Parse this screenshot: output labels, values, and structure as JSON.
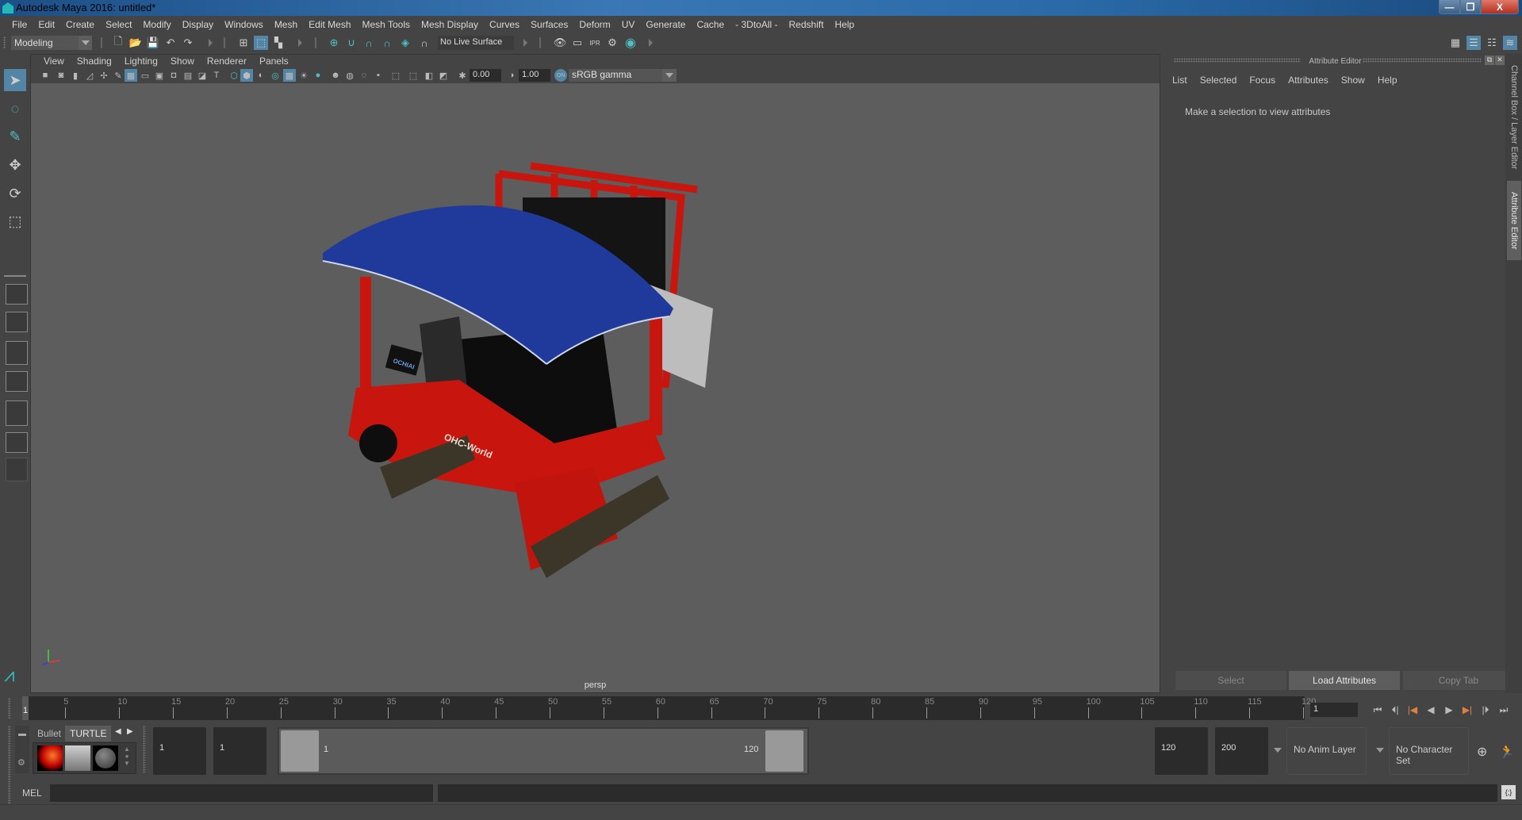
{
  "window": {
    "title": "Autodesk Maya 2016: untitled*",
    "controls": {
      "minimize": "—",
      "maximize": "❐",
      "close": "X"
    }
  },
  "menubar": {
    "items": [
      "File",
      "Edit",
      "Create",
      "Select",
      "Modify",
      "Display",
      "Windows",
      "Mesh",
      "Edit Mesh",
      "Mesh Tools",
      "Mesh Display",
      "Curves",
      "Surfaces",
      "Deform",
      "UV",
      "Generate",
      "Cache",
      "- 3DtoAll -",
      "Redshift",
      "Help"
    ]
  },
  "statusline": {
    "mode": "Modeling",
    "live_surface": "No Live Surface",
    "icons": [
      "new-scene",
      "open-scene",
      "save-scene",
      "undo",
      "redo",
      "select-by-hierarchy",
      "select-by-object",
      "select-by-component",
      "snap-to-grid",
      "snap-to-curve",
      "snap-to-point",
      "snap-to-view-plane",
      "make-live",
      "snap-to-surface",
      "render-view",
      "render-current-frame",
      "ipr-render",
      "render-settings",
      "hypershade"
    ]
  },
  "toolbox": {
    "tools": [
      "select-tool",
      "lasso-tool",
      "paint-select-tool",
      "move-tool",
      "rotate-tool",
      "scale-tool"
    ],
    "layouts": [
      "single-pane",
      "four-pane",
      "outliner-persp",
      "persp-graph",
      "hypershade-persp",
      "persp-graph-outliner"
    ]
  },
  "viewport": {
    "menu": [
      "View",
      "Shading",
      "Lighting",
      "Show",
      "Renderer",
      "Panels"
    ],
    "exposure": "0.00",
    "gamma": "1.00",
    "color_space": "sRGB gamma",
    "color_mgmt_badge": "ON",
    "camera": "persp",
    "axis": {
      "x": "x",
      "y": "y",
      "z": "z"
    },
    "model": {
      "body_color": "#c8160e",
      "canopy_color": "#1f3a9a",
      "decal_brand": "OCHIAI",
      "decal_text": "OHC-World"
    }
  },
  "attribute_editor": {
    "title": "Attribute Editor",
    "menu": [
      "List",
      "Selected",
      "Focus",
      "Attributes",
      "Show",
      "Help"
    ],
    "message": "Make a selection to view attributes",
    "buttons": {
      "select": "Select",
      "load": "Load Attributes",
      "copy": "Copy Tab"
    }
  },
  "side_tabs": {
    "channel_box": "Channel Box / Layer Editor",
    "attribute_editor": "Attribute Editor"
  },
  "time_slider": {
    "start": 1,
    "end": 120,
    "tick_labels": [
      5,
      10,
      15,
      20,
      25,
      30,
      35,
      40,
      45,
      50,
      55,
      60,
      65,
      70,
      75,
      80,
      85,
      90,
      95,
      100,
      105,
      110,
      115,
      120
    ],
    "current_label": "1",
    "current_frame": "1"
  },
  "playback": [
    "go-to-start",
    "step-back-frame",
    "step-back-key",
    "play-backwards",
    "play-forwards",
    "step-forward-key",
    "step-forward-frame",
    "go-to-end"
  ],
  "range": {
    "shelf_tabs": [
      "Bullet",
      "TURTLE"
    ],
    "anim_start": "1",
    "range_start": "1",
    "range_start_label": "1",
    "range_end_label": "120",
    "range_end": "120",
    "anim_end": "200",
    "anim_layer": "No Anim Layer",
    "character_set": "No Character Set"
  },
  "command_line": {
    "label": "MEL",
    "value": ""
  },
  "accent_color": "#5285a6"
}
